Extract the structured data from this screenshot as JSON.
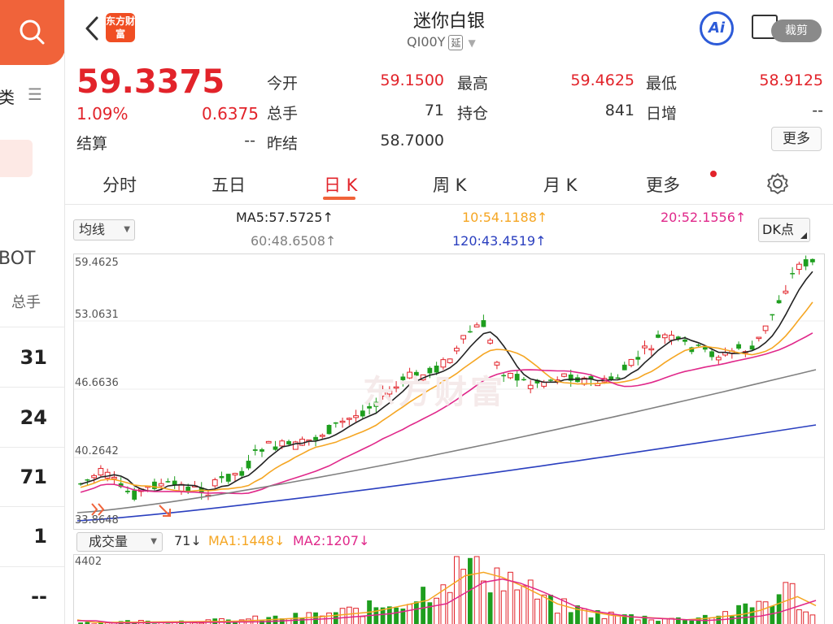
{
  "left_panel": {
    "category_label": "类",
    "bot_label": "BOT",
    "vol_label": "总手",
    "numbers": [
      "31",
      "24",
      "71",
      "1",
      "--"
    ]
  },
  "header": {
    "title": "迷你白银",
    "code": "QI00Y",
    "delay_tag": "延",
    "brand": "东方财富",
    "ai_label": "Ai",
    "crop_label": "裁剪"
  },
  "quote": {
    "price": "59.3375",
    "change_pct": "1.09%",
    "change": "0.6375",
    "fields": [
      {
        "label": "今开",
        "value": "59.1500"
      },
      {
        "label": "最高",
        "value": "59.4625"
      },
      {
        "label": "最低",
        "value": "58.9125"
      },
      {
        "label": "总手",
        "value": "71"
      },
      {
        "label": "持仓",
        "value": "841"
      },
      {
        "label": "日增",
        "value": "--"
      },
      {
        "label": "结算",
        "value": "--"
      },
      {
        "label": "昨结",
        "value": "58.7000"
      }
    ],
    "more_label": "更多"
  },
  "tabs": [
    "分时",
    "五日",
    "日 K",
    "周 K",
    "月 K",
    "更多"
  ],
  "ma_row": {
    "select_label": "均线",
    "ma5": "MA5:57.5725↑",
    "ma10": "10:54.1188↑",
    "ma20": "20:52.1556↑",
    "ma60": "60:48.6508↑",
    "ma120": "120:43.4519↑",
    "dk_label": "DK点"
  },
  "chart_labels": {
    "y_ticks": [
      "59.4625",
      "53.0631",
      "46.6636",
      "40.2642",
      "33.8648"
    ],
    "watermark": "东方财富"
  },
  "volume": {
    "select_label": "成交量",
    "current": "71↓",
    "ma1": "MA1:1448↓",
    "ma2": "MA2:1207↓",
    "max": "4402"
  },
  "colors": {
    "up": "#e2232a",
    "down": "#1e9e1e",
    "ma5": "#222222",
    "ma10": "#f5a623",
    "ma20": "#e0288a",
    "ma60": "#808080",
    "ma120": "#2a3fbf",
    "accent": "#f0633a"
  }
}
